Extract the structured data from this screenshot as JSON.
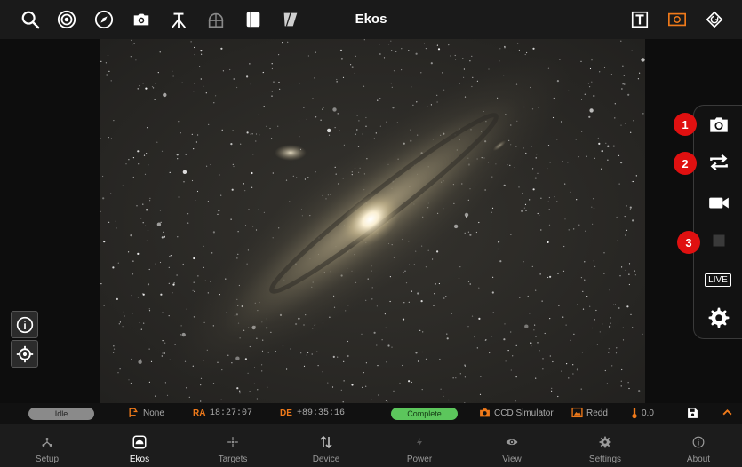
{
  "app": {
    "title": "Ekos"
  },
  "toolbar": {
    "left_icons": [
      "search-icon",
      "target-icon",
      "compass-icon",
      "camera-icon",
      "tripod-icon",
      "dome-icon",
      "flat-panel-icon",
      "filter-wheel-icon"
    ],
    "right_icons": [
      "text-toggle-icon",
      "frame-toggle-icon",
      "rotate-toggle-icon"
    ],
    "active_color": "#f07a1a"
  },
  "side_panel": {
    "buttons": [
      {
        "icon": "camera-capture-icon",
        "badge": "1"
      },
      {
        "icon": "loop-icon",
        "badge": "2"
      },
      {
        "icon": "video-icon",
        "badge": ""
      },
      {
        "icon": "stop-icon",
        "badge": "3"
      },
      {
        "icon": "live-icon",
        "badge": "",
        "label": "LIVE"
      },
      {
        "icon": "settings-gear-icon",
        "badge": ""
      }
    ],
    "badge_color": "#e01010"
  },
  "left_tools": [
    "info-icon",
    "crosshair-icon"
  ],
  "status": {
    "mount_state": "Idle",
    "pier_side": "None",
    "ra_label": "RA",
    "ra_value": "18:27:07",
    "de_label": "DE",
    "de_value": "+89:35:16",
    "capture_state": "Complete",
    "camera": "CCD Simulator",
    "filter": "Redd",
    "temperature": "0.0"
  },
  "nav": {
    "items": [
      {
        "label": "Setup",
        "icon": "setup-icon"
      },
      {
        "label": "Ekos",
        "icon": "ekos-icon",
        "active": true
      },
      {
        "label": "Targets",
        "icon": "targets-icon"
      },
      {
        "label": "Device",
        "icon": "device-icon"
      },
      {
        "label": "Power",
        "icon": "power-icon"
      },
      {
        "label": "View",
        "icon": "view-icon"
      },
      {
        "label": "Settings",
        "icon": "settings-icon"
      },
      {
        "label": "About",
        "icon": "about-icon"
      }
    ]
  }
}
